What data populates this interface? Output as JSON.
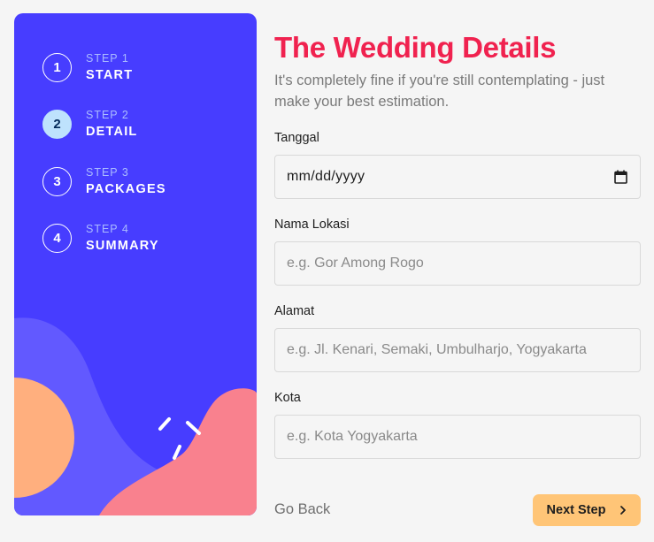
{
  "steps": [
    {
      "number": "1",
      "sub": "STEP 1",
      "title": "START"
    },
    {
      "number": "2",
      "sub": "STEP 2",
      "title": "DETAIL"
    },
    {
      "number": "3",
      "sub": "STEP 3",
      "title": "PACKAGES"
    },
    {
      "number": "4",
      "sub": "STEP 4",
      "title": "SUMMARY"
    }
  ],
  "active_step": 2,
  "form": {
    "title": "The Wedding Details",
    "subtitle": "It's completely fine if you're still contemplating - just make your best estimation.",
    "fields": [
      {
        "label": "Tanggal",
        "value": "mm/dd/yyyy",
        "type": "date"
      },
      {
        "label": "Nama Lokasi",
        "placeholder": "e.g. Gor Among Rogo"
      },
      {
        "label": "Alamat",
        "placeholder": "e.g. Jl. Kenari, Semaki, Umbulharjo, Yogyakarta"
      },
      {
        "label": "Kota",
        "placeholder": "e.g. Kota Yogyakarta"
      }
    ]
  },
  "buttons": {
    "back": "Go Back",
    "next": "Next Step"
  },
  "icons": {
    "date": "calendar-icon",
    "next": "chevron-right-icon"
  },
  "colors": {
    "sidebar": "#473dff",
    "title": "#f0224f",
    "next_button": "#ffc577",
    "active_step": "#bee2fd"
  }
}
